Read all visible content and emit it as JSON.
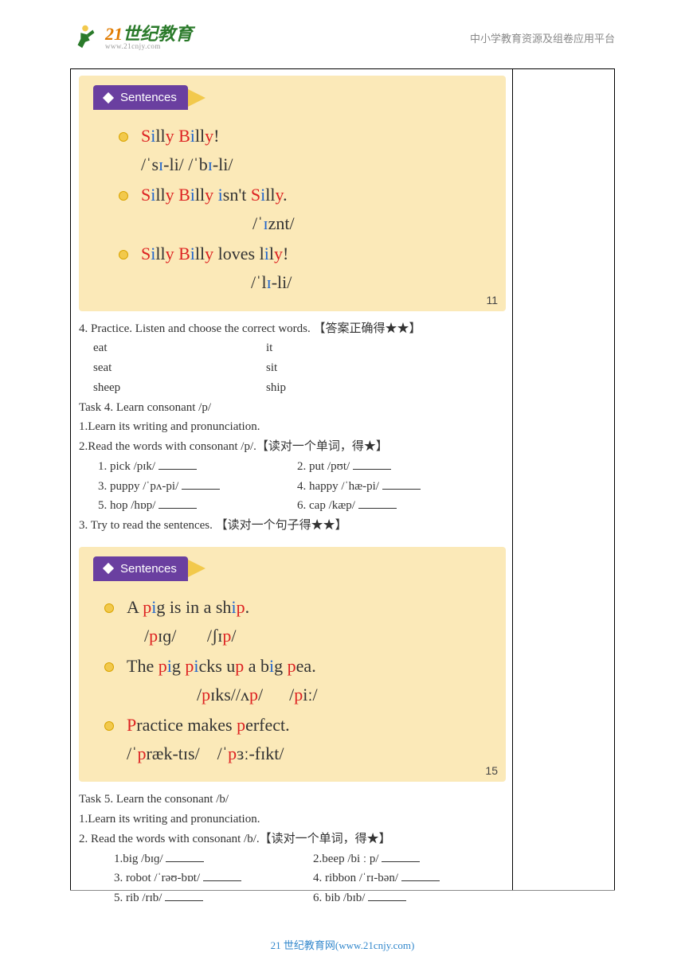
{
  "header": {
    "logo_main_a": "21",
    "logo_main_b": "世纪教育",
    "logo_sub": "www.21cnjy.com",
    "right_text": "中小学教育资源及组卷应用平台"
  },
  "card1": {
    "tab": "Sentences",
    "line1_text": "Silly Billy!",
    "line1_ipa": "/ˈsɪ-li/ /ˈbɪ-li/",
    "line2_text": "Silly Billy isn't Silly.",
    "line2_ipa": "/ˈɪznt/",
    "line3_text": "Silly Billy loves lily!",
    "line3_ipa": "/ˈlɪ-li/",
    "num": "11"
  },
  "practice4": {
    "title": "4. Practice. Listen and choose the correct words. 【答案正确得★★】",
    "pairs": [
      {
        "a": "eat",
        "b": "it"
      },
      {
        "a": "seat",
        "b": "sit"
      },
      {
        "a": "sheep",
        "b": "ship"
      }
    ]
  },
  "task4": {
    "title": "Task 4. Learn consonant /p/",
    "line1": "1.Learn its writing and pronunciation.",
    "line2": "2.Read the words with consonant /p/.【读对一个单词，得★】",
    "words": [
      {
        "a": "1. pick /pɪk/",
        "b": "2. put /pʊt/"
      },
      {
        "a": "3. puppy /ˈpʌ-pi/",
        "b": "4. happy /ˈhæ-pi/"
      },
      {
        "a": "5. hop /hɒp/",
        "b": "6. cap /kæp/"
      }
    ],
    "line3": "3. Try to read the sentences. 【读对一个句子得★★】"
  },
  "card2": {
    "tab": "Sentences",
    "line1_text": "A pig is in a ship.",
    "line1_ipa": "/pɪɡ/        /ʃɪp/",
    "line2_text": "The pig picks up a big pea.",
    "line2_ipa": "/pɪks//ʌp/       /piː/",
    "line3_text": "Practice makes perfect.",
    "line3_ipa": "/ˈpræk-tɪs/     /ˈpɜː-fɪkt/",
    "num": "15"
  },
  "task5": {
    "title": "Task 5. Learn the consonant /b/",
    "line1": "1.Learn its writing and pronunciation.",
    "line2": "2. Read the words with consonant /b/.【读对一个单词，得★】",
    "words": [
      {
        "a": "1.big /bɪɡ/",
        "b": "2.beep /bi ː p/"
      },
      {
        "a": "3. robot /ˈrəʊ-bɒt/",
        "b": "4. ribbon /ˈrɪ-bən/"
      },
      {
        "a": "5. rib /rɪb/",
        "b": "6. bib /bɪb/"
      }
    ]
  },
  "footer": "21 世纪教育网(www.21cnjy.com)"
}
